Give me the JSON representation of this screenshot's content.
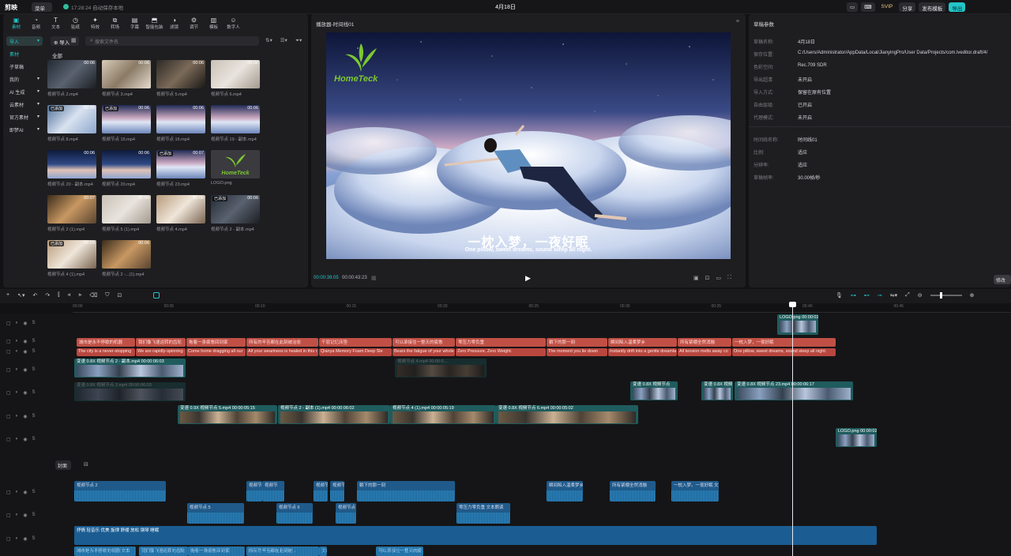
{
  "titlebar": {
    "app_name": "剪映",
    "menu_label": "菜单",
    "save_status": "17:28:24 自动保存本地",
    "project_title": "4月18日",
    "svip": "SVIP",
    "share": "分享",
    "publish": "发布模板",
    "export": "导出"
  },
  "tool_tabs": [
    {
      "label": "素材",
      "icon": "▣"
    },
    {
      "label": "音频",
      "icon": "◔"
    },
    {
      "label": "文本",
      "icon": "T"
    },
    {
      "label": "贴纸",
      "icon": "◷"
    },
    {
      "label": "特效",
      "icon": "✦"
    },
    {
      "label": "转场",
      "icon": "⧉"
    },
    {
      "label": "字幕",
      "icon": "▤"
    },
    {
      "label": "智能包装",
      "icon": "⬒"
    },
    {
      "label": "滤镜",
      "icon": "◑"
    },
    {
      "label": "调节",
      "icon": "⚙"
    },
    {
      "label": "模板",
      "icon": "▥"
    },
    {
      "label": "数字人",
      "icon": "☺"
    }
  ],
  "side_cats": [
    {
      "label": "导入",
      "arrow": "▾"
    },
    {
      "label": "素材",
      "arrow": ""
    },
    {
      "label": "子草稿",
      "arrow": ""
    },
    {
      "label": "我的",
      "arrow": "▾"
    },
    {
      "label": "AI 生成",
      "arrow": "▾"
    },
    {
      "label": "云素材",
      "arrow": "▾"
    },
    {
      "label": "官方素材",
      "arrow": "▾"
    },
    {
      "label": "即梦AI",
      "arrow": "▾"
    }
  ],
  "media": {
    "import_label": "导入",
    "search_placeholder": "搜索文件名",
    "all_label": "全部",
    "items": [
      {
        "name": "视频节点 2.mp4",
        "dur": "00:06",
        "added": "",
        "theme": "crowd"
      },
      {
        "name": "视频节点 3.mp4",
        "dur": "00:06",
        "added": "",
        "theme": "room"
      },
      {
        "name": "视频节点 5.mp4",
        "dur": "00:06",
        "added": "",
        "theme": "office"
      },
      {
        "name": "视频节点 6.mp4",
        "dur": "00:06",
        "added": "",
        "theme": "bed"
      },
      {
        "name": "视频节点 8.mp4",
        "dur": "00:06",
        "added": "已添加",
        "theme": "woman"
      },
      {
        "name": "视频节点 15.mp4",
        "dur": "00:06",
        "added": "已添加",
        "theme": "cloud"
      },
      {
        "name": "视频节点 16.mp4",
        "dur": "00:06",
        "added": "",
        "theme": "cloud"
      },
      {
        "name": "视频节点 19 - 副本.mp4",
        "dur": "00:06",
        "added": "",
        "theme": "cloud"
      },
      {
        "name": "视频节点 20 - 副本.mp4",
        "dur": "00:06",
        "added": "",
        "theme": "sky"
      },
      {
        "name": "视频节点 20.mp4",
        "dur": "00:06",
        "added": "",
        "theme": "sky"
      },
      {
        "name": "视频节点 23.mp4",
        "dur": "00:07",
        "added": "已添加",
        "theme": "cloud"
      },
      {
        "name": "LOGO.png",
        "dur": "",
        "added": "",
        "theme": "logo"
      },
      {
        "name": "视频节点 2 (1).mp4",
        "dur": "00:07",
        "added": "",
        "theme": "hotel"
      },
      {
        "name": "视频节点 5 (1).mp4",
        "dur": "00:06",
        "added": "",
        "theme": "bed"
      },
      {
        "name": "视频节点 4.mp4",
        "dur": "00:06",
        "added": "",
        "theme": "pillow"
      },
      {
        "name": "视频节点 2 - 副本.mp4",
        "dur": "00:06",
        "added": "已添加",
        "theme": "crowd"
      },
      {
        "name": "视频节点 4 (1).mp4",
        "dur": "00:09",
        "added": "已添加",
        "theme": "pillow"
      },
      {
        "name": "视频节点 2 -...(1).mp4",
        "dur": "00:06",
        "added": "",
        "theme": "hotel"
      }
    ]
  },
  "player": {
    "title": "播放器-时间线01",
    "watermark": "HomeTeck",
    "subtitle_cn": "一枕入梦，一夜好眠",
    "subtitle_en": "One pillow, sweet dreams, sound sleep all night.",
    "time_current": "00:00:39:05",
    "time_total": "00:00:43:23"
  },
  "props": {
    "title": "草稿参数",
    "rows": [
      {
        "k": "草稿名称:",
        "v": "4月18日"
      },
      {
        "k": "保存位置:",
        "v": "C:/Users/Administrator/AppData/Local/JianyingPro/User Data/Projects/com.lveditor.draft/4/"
      },
      {
        "k": "色彩空间:",
        "v": "Rec.709 SDR"
      },
      {
        "k": "导入方式:",
        "v": "保留在原有位置"
      },
      {
        "k": "自由层级:",
        "v": "已开启"
      },
      {
        "k": "代理模式:",
        "v": "未开启"
      },
      {
        "k": "时间线名称:",
        "v": "时间线01"
      },
      {
        "k": "比例:",
        "v": "适应"
      },
      {
        "k": "分辨率:",
        "v": "适应"
      },
      {
        "k": "草稿帧率:",
        "v": "30.00帧/秒"
      }
    ],
    "hdr_label": "导出超清",
    "hdr_value": "未开启",
    "modify": "修改"
  },
  "timeline": {
    "cover_label": "封面",
    "ruler": [
      "00:00",
      "00:05",
      "00:10",
      "00:15",
      "00:20",
      "00:25",
      "00:30",
      "00:35",
      "00:40",
      "00:45"
    ],
    "title_clips": [
      {
        "t": "城市是永不停歇的机器"
      },
      {
        "t": "我们像飞速运转的齿轮"
      },
      {
        "t": "拖着一身疲惫回到家"
      },
      {
        "t": "所有的辛苦都在此刻被治愈"
      },
      {
        "t": "千层记忆床垫"
      },
      {
        "t": "可以承接住一整天的疲惫"
      },
      {
        "t": "零压力零负重"
      },
      {
        "t": "躺下的那一刻"
      },
      {
        "t": "瞬间陷入温柔梦乡"
      },
      {
        "t": "所有紧绷全然消融"
      },
      {
        "t": "一枕入梦，一夜好眠"
      }
    ],
    "text_clips": [
      {
        "t": "The city is a never-stopping"
      },
      {
        "t": "We are rapidly-spinning"
      },
      {
        "t": "Come home dragging all our"
      },
      {
        "t": "All your weariness is healed in this r"
      },
      {
        "t": "Qianya Memory Foam Deep Sle"
      },
      {
        "t": "Bears the fatigue of your whole da"
      },
      {
        "t": "Zero Pressure, Zero Weight."
      },
      {
        "t": "The moment you lie down"
      },
      {
        "t": "Instantly drift into a gentle dreamla"
      },
      {
        "t": "All tension melts away co"
      },
      {
        "t": "One pillow, sweet dreams, sound sleep all night."
      }
    ],
    "logo_label": "LOGO.png  00:00:02",
    "v1_label": "变速 0.8X  视频节点 2 - 副本.mp4  00:00:06:03",
    "v1_ghost": "变速 0.8X  视频节点 2.mp4  00:00:06:03",
    "v_mid": [
      "视频节点 4.mp4  00:00:0..."
    ],
    "v2": [
      {
        "t": "变速 0.8X  视频节点"
      },
      {
        "t": "变速 0.8X  视频节点"
      },
      {
        "t": "变速 0.8X  视频节点 23.mp4  00:00:06:17"
      }
    ],
    "v3": [
      {
        "t": "变速 0.9X  视频节点 5.mp4  00:00:05:15"
      },
      {
        "t": "视频节点 2 - 副本 (1).mp4  00:00:06:02"
      },
      {
        "t": "视频节点 4 (1).mp4  00:00:05:19"
      },
      {
        "t": "变速 0.8X  视频节点 6.mp4  00:00:05:02"
      }
    ],
    "logo2": "LOGO.png  00:00:02",
    "audio1": [
      {
        "t": "视频节点 2"
      },
      {
        "t": "视频节"
      },
      {
        "t": "视频节"
      },
      {
        "t": "视频节"
      },
      {
        "t": "视频节点 23"
      },
      {
        "t": "躺下的那一刻"
      },
      {
        "t": "瞬间陷入温柔梦乡"
      },
      {
        "t": "所有紧绷全然消融"
      },
      {
        "t": "一枕入梦。一夜好眠  文本朗"
      }
    ],
    "audio2": [
      {
        "t": "视频节点 5"
      },
      {
        "t": "视频节点 6"
      },
      {
        "t": "视频节点"
      },
      {
        "t": "零压力零负重  文本朗读"
      }
    ],
    "bgm": "抒情 轻音乐 优美 旋律 舒缓 放松 钢琴 睡眠",
    "voice": [
      {
        "t": "城市是永不停歇的机器  文本"
      },
      {
        "t": "我们像飞速运转的齿轮"
      },
      {
        "t": "拖着一身疲惫回到家"
      },
      {
        "t": "所有的辛苦都在此刻被..."
      },
      {
        "t": "文本"
      },
      {
        "t": "可以承接住一整天的疲..."
      }
    ]
  }
}
